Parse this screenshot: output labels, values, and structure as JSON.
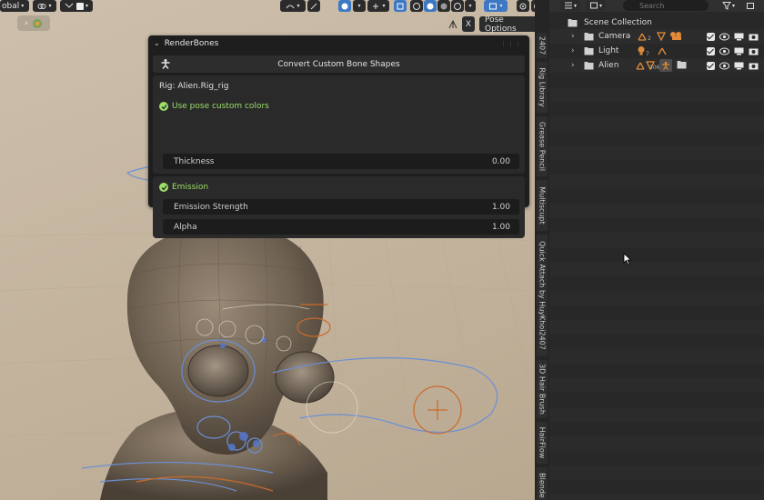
{
  "toolbar": {
    "transform_orientation": "obal",
    "pose_options_label": "Pose Options",
    "pose_x_label": "X"
  },
  "render_bones_panel": {
    "title": "RenderBones",
    "convert_button_label": "Convert Custom Bone Shapes",
    "rig_label": "Rig: Alien.Rig_rig",
    "use_pose_colors_label": "Use pose custom colors",
    "thickness_label": "Thickness",
    "thickness_value": "0.00",
    "emission_label": "Emission",
    "emission_strength_label": "Emission Strength",
    "emission_strength_value": "1.00",
    "alpha_label": "Alpha",
    "alpha_value": "1.00",
    "accent_color": "#9bde6a"
  },
  "side_tabs": [
    {
      "label": "2407"
    },
    {
      "label": "Rig Library"
    },
    {
      "label": "Grease Pencil"
    },
    {
      "label": "Multiscupt"
    },
    {
      "label": "Quick Attach by HuyKhoi2407"
    },
    {
      "label": "3D Hair Brush"
    },
    {
      "label": "HairFlow"
    },
    {
      "label": "Blende"
    }
  ],
  "outliner": {
    "search_placeholder": "Search",
    "scene_collection_label": "Scene Collection",
    "rows": [
      {
        "label": "Camera",
        "badge": "2"
      },
      {
        "label": "Light",
        "badge": "7"
      },
      {
        "label": "Alien",
        "badge": "306"
      }
    ]
  },
  "colors": {
    "viewport_bg": "#c4b49e",
    "active_blue": "#3d78c4",
    "bone_orange": "#c96a2a",
    "bone_blue": "#6b8fd6"
  }
}
